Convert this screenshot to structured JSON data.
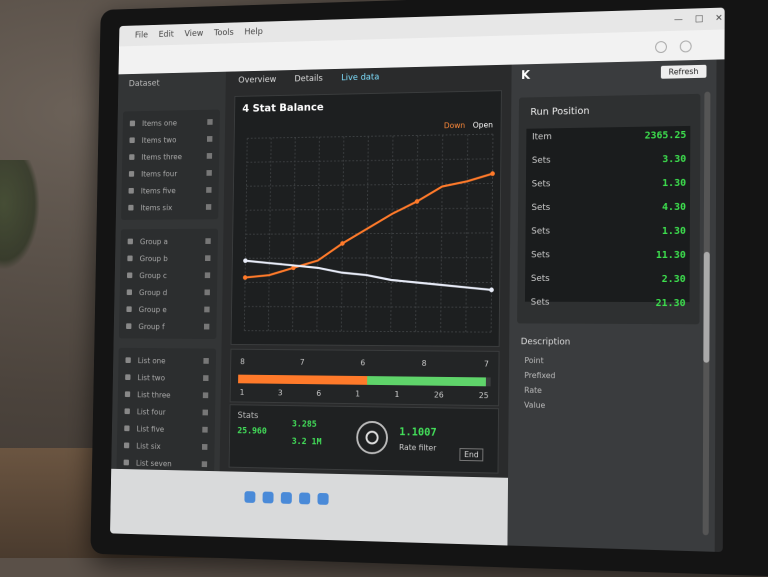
{
  "colors": {
    "accent_orange": "#ff7a2a",
    "accent_green": "#43e05a",
    "series_white": "#e8ecf8",
    "panel_dark": "#1d1f20"
  },
  "topbar": {
    "items": [
      "File",
      "Edit",
      "View",
      "Tools",
      "Help"
    ],
    "controls": [
      "—",
      "□",
      "✕"
    ]
  },
  "sidebar": {
    "header": "Dataset",
    "groups": [
      {
        "items": [
          "Items one",
          "Items two",
          "Items three",
          "Items four",
          "Items five",
          "Items six"
        ]
      },
      {
        "items": [
          "Group a",
          "Group b",
          "Group c",
          "Group d",
          "Group e",
          "Group f"
        ]
      },
      {
        "items": [
          "List one",
          "List two",
          "List three",
          "List four",
          "List five",
          "List six",
          "List seven"
        ]
      }
    ]
  },
  "main": {
    "tabs": [
      "Overview",
      "Details",
      "Live data"
    ],
    "chart_title": "4 Stat Balance",
    "legend": [
      "Down",
      "Open"
    ]
  },
  "chart_data": {
    "type": "line",
    "title": "4 Stat Balance",
    "x": [
      0,
      1,
      2,
      3,
      4,
      5,
      6,
      7,
      8,
      9,
      10
    ],
    "series": [
      {
        "name": "Down",
        "color": "#ff7a2a",
        "values": [
          2.2,
          2.3,
          2.6,
          2.9,
          3.6,
          4.2,
          4.8,
          5.3,
          5.9,
          6.1,
          6.4
        ]
      },
      {
        "name": "Open",
        "color": "#e8ecf8",
        "values": [
          2.9,
          2.8,
          2.7,
          2.6,
          2.4,
          2.3,
          2.1,
          2.0,
          1.9,
          1.8,
          1.7
        ]
      }
    ],
    "xlim": [
      0,
      10
    ],
    "ylim": [
      0,
      8
    ],
    "grid": true,
    "legend_position": "top-right"
  },
  "progress": {
    "top_labels": [
      "8",
      "7",
      "6",
      "8",
      "7"
    ],
    "bottom_labels": [
      "1",
      "3",
      "6",
      "1",
      "1",
      "26",
      "25"
    ],
    "orange_fraction": 0.52,
    "green_fraction": 0.46
  },
  "bottom_panel": {
    "left_label": "Stats",
    "left_value": "25.960",
    "mid_value_1": "3.285",
    "mid_value_2": "3.2 1M",
    "right_value": "1.1007",
    "right_caption": "Rate filter",
    "badge": "End"
  },
  "right_panel": {
    "header_btn": "Refresh",
    "close": "K",
    "card_title": "Run Position",
    "rows": [
      {
        "label": "Item",
        "value": "2365.25"
      },
      {
        "label": "Sets",
        "value": "3.30"
      },
      {
        "label": "Sets",
        "value": "1.30"
      },
      {
        "label": "Sets",
        "value": "4.30"
      },
      {
        "label": "Sets",
        "value": "1.30"
      },
      {
        "label": "Sets",
        "value": "11.30"
      },
      {
        "label": "Sets",
        "value": "2.30"
      },
      {
        "label": "Sets",
        "value": "21.30"
      }
    ],
    "desc_title": "Description",
    "desc_lines": [
      "Point",
      "Prefixed",
      "Rate",
      "Value"
    ]
  }
}
